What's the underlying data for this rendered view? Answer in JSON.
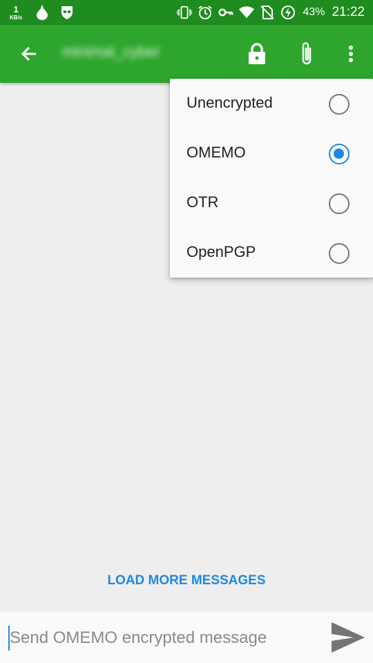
{
  "status_bar": {
    "net_speed_value": "1",
    "net_speed_unit": "KB/s",
    "battery_percent": "43%",
    "time": "21:22",
    "icons": [
      "tor-onion-icon",
      "privacy-mask-icon",
      "vibrate-icon",
      "alarm-icon",
      "vpn-key-icon",
      "wifi-icon",
      "no-sim-icon",
      "battery-charging-icon"
    ]
  },
  "toolbar": {
    "contact_name": "minimal_cyber",
    "icons": [
      "back-arrow-icon",
      "lock-icon",
      "paperclip-icon",
      "more-vert-icon"
    ]
  },
  "encryption_menu": {
    "items": [
      {
        "label": "Unencrypted",
        "selected": false
      },
      {
        "label": "OMEMO",
        "selected": true
      },
      {
        "label": "OTR",
        "selected": false
      },
      {
        "label": "OpenPGP",
        "selected": false
      }
    ]
  },
  "conversation": {
    "load_more_label": "LOAD MORE MESSAGES"
  },
  "composer": {
    "placeholder": "Send OMEMO encrypted message",
    "send_icon": "send-icon"
  },
  "colors": {
    "status_bar": "#1e8c1e",
    "toolbar": "#2ea62e",
    "accent": "#1e88e5",
    "background": "#eeeeee"
  }
}
